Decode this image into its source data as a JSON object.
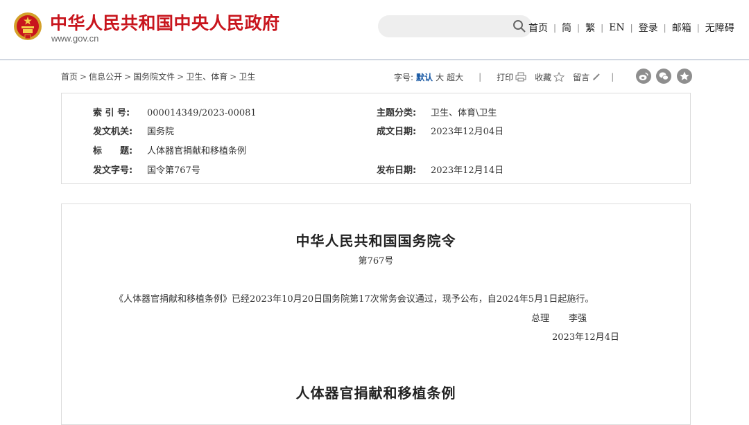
{
  "header": {
    "site_title": "中华人民共和国中央人民政府",
    "site_domain": "www.gov.cn",
    "search": {
      "placeholder": ""
    },
    "nav": [
      "首页",
      "简",
      "繁",
      "EN",
      "登录",
      "邮箱",
      "无障碍"
    ]
  },
  "breadcrumb": [
    "首页",
    "信息公开",
    "国务院文件",
    "卫生、体育",
    "卫生"
  ],
  "tools": {
    "font_label": "字号:",
    "font_sizes": [
      "默认",
      "大",
      "超大"
    ],
    "print": "打印",
    "favorite": "收藏",
    "comment": "留言",
    "share_icons": [
      "weibo-icon",
      "wechat-icon",
      "star-icon"
    ]
  },
  "info": {
    "index_label": "索 引 号:",
    "index_value": "000014349/2023-00081",
    "topic_label": "主题分类:",
    "topic_value": "卫生、体育\\卫生",
    "issuer_label": "发文机关:",
    "issuer_value": "国务院",
    "written_label": "成文日期:",
    "written_value": "2023年12月04日",
    "title_label": "标　　题:",
    "title_value": "人体器官捐献和移植条例",
    "docno_label": "发文字号:",
    "docno_value": "国令第767号",
    "published_label": "发布日期:",
    "published_value": "2023年12月14日"
  },
  "document": {
    "title": "中华人民共和国国务院令",
    "number": "第767号",
    "paragraph": "《人体器官捐献和移植条例》已经2023年10月20日国务院第17次常务会议通过，现予公布，自2024年5月1日起施行。",
    "signer_role": "总理",
    "signer_name": "李强",
    "date": "2023年12月4日",
    "subtitle": "人体器官捐献和移植条例"
  },
  "colors": {
    "brand_red": "#c8151d",
    "accent_blue": "#1a5aa5"
  }
}
